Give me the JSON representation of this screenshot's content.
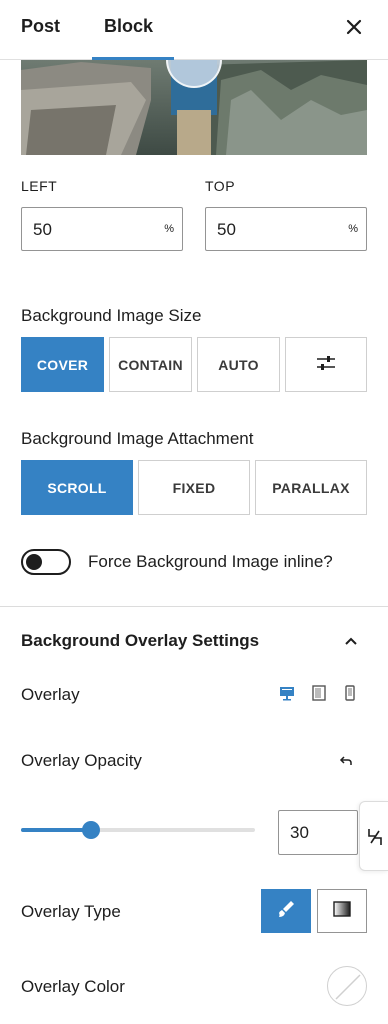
{
  "header": {
    "tabs": [
      {
        "label": "Post",
        "active": false
      },
      {
        "label": "Block",
        "active": true
      }
    ],
    "close_icon": "close-icon"
  },
  "position": {
    "left": {
      "label": "LEFT",
      "value": "50",
      "unit": "%"
    },
    "top": {
      "label": "TOP",
      "value": "50",
      "unit": "%"
    }
  },
  "size": {
    "label": "Background Image Size",
    "options": [
      "COVER",
      "CONTAIN",
      "AUTO"
    ],
    "selected": "COVER",
    "custom_icon": "sliders-icon"
  },
  "attachment": {
    "label": "Background Image Attachment",
    "options": [
      "SCROLL",
      "FIXED",
      "PARALLAX"
    ],
    "selected": "SCROLL"
  },
  "inline_toggle": {
    "label": "Force Background Image inline?",
    "enabled": false
  },
  "overlay": {
    "title": "Background Overlay Settings",
    "overlay_label": "Overlay",
    "devices": [
      "desktop-icon",
      "tablet-icon",
      "mobile-icon"
    ],
    "opacity_label": "Overlay Opacity",
    "opacity_value": "30",
    "opacity_fraction": 0.3,
    "type_label": "Overlay Type",
    "type_options": [
      "brush-icon",
      "gradient-icon"
    ],
    "color_label": "Overlay Color"
  },
  "colors": {
    "accent": "#3582c4",
    "text": "#1e1e1e",
    "border": "#949494"
  }
}
